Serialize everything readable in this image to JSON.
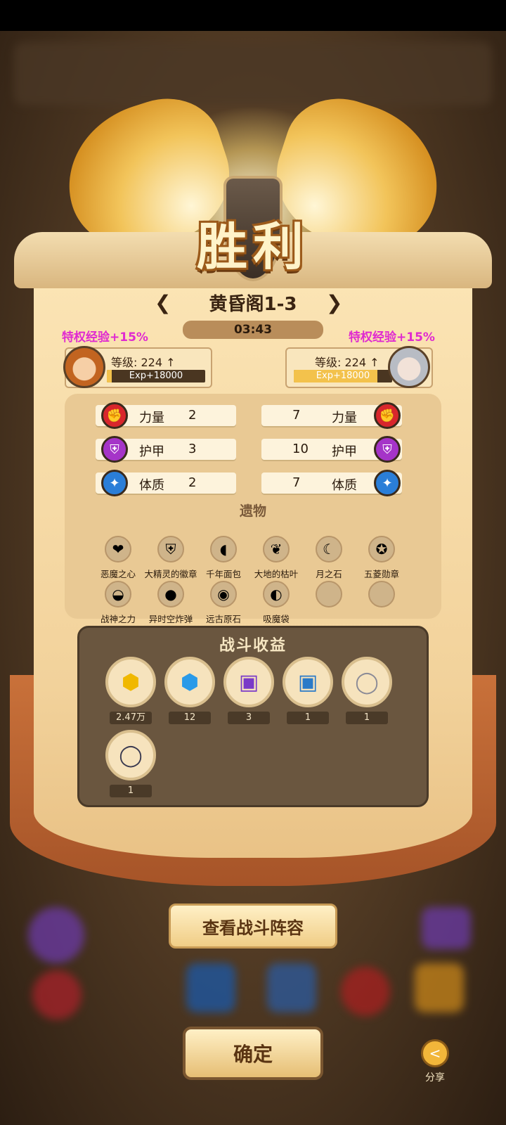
{
  "header": {
    "title": "胜利",
    "stage": "黄昏阁1-3",
    "timer": "03:43",
    "prev_arrow": "❮",
    "next_arrow": "❯"
  },
  "players": [
    {
      "privilege": "特权经验+15%",
      "level_label": "等级: 224",
      "up_icon": "↑",
      "exp_text": "Exp+18000",
      "exp_fill": 0.05
    },
    {
      "privilege": "特权经验+15%",
      "level_label": "等级: 224",
      "up_icon": "↑",
      "exp_text": "Exp+18000",
      "exp_fill": 0.85
    }
  ],
  "stats": {
    "left": [
      {
        "name": "力量",
        "value": "2"
      },
      {
        "name": "护甲",
        "value": "3"
      },
      {
        "name": "体质",
        "value": "2"
      }
    ],
    "right": [
      {
        "name": "力量",
        "value": "7"
      },
      {
        "name": "护甲",
        "value": "10"
      },
      {
        "name": "体质",
        "value": "7"
      }
    ],
    "icons": [
      "fist-icon",
      "armor-icon",
      "body-icon"
    ],
    "icon_colors": [
      "#d8262c",
      "#a534c8",
      "#2a7ed8"
    ]
  },
  "relics": {
    "title": "遗物",
    "items": [
      {
        "label": "恶魔之心",
        "icon": "heart-icon"
      },
      {
        "label": "大精灵的徽章",
        "icon": "badge-icon"
      },
      {
        "label": "千年面包",
        "icon": "bread-icon"
      },
      {
        "label": "大地的枯叶",
        "icon": "leaf-icon"
      },
      {
        "label": "月之石",
        "icon": "moonstone-icon"
      },
      {
        "label": "五菱勋章",
        "icon": "medal-icon"
      },
      {
        "label": "战神之力",
        "icon": "bowl-icon"
      },
      {
        "label": "异时空炸弹",
        "icon": "bomb-icon"
      },
      {
        "label": "远古原石",
        "icon": "gem-icon"
      },
      {
        "label": "吸魔袋",
        "icon": "bag-icon"
      },
      {
        "label": "",
        "icon": "empty-slot"
      },
      {
        "label": "",
        "icon": "empty-slot"
      }
    ]
  },
  "loot": {
    "title": "战斗收益",
    "items": [
      {
        "count": "2.47万",
        "icon": "gold-gem-icon"
      },
      {
        "count": "12",
        "icon": "blue-gem-icon"
      },
      {
        "count": "3",
        "icon": "purple-monster-card-icon"
      },
      {
        "count": "1",
        "icon": "blue-monster-card-icon"
      },
      {
        "count": "1",
        "icon": "silver-ring-icon"
      },
      {
        "count": "1",
        "icon": "dark-ring-icon"
      }
    ]
  },
  "buttons": {
    "view_lineup": "查看战斗阵容",
    "confirm": "确定",
    "share": "分享"
  }
}
